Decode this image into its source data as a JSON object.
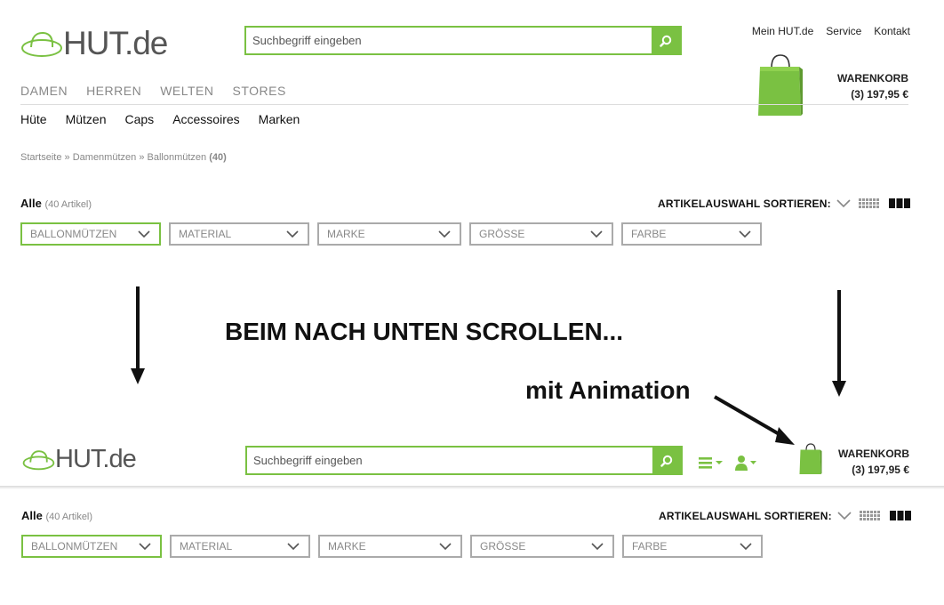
{
  "header": {
    "logo_text": "HUT.de",
    "search_placeholder": "Suchbegriff eingeben",
    "top_links": [
      "Mein HUT.de",
      "Service",
      "Kontakt"
    ],
    "cart_title": "WARENKORB",
    "cart_summary": "(3) 197,95 €"
  },
  "main_nav": [
    "DAMEN",
    "HERREN",
    "WELTEN",
    "STORES"
  ],
  "sub_nav": [
    "Hüte",
    "Mützen",
    "Caps",
    "Accessoires",
    "Marken"
  ],
  "breadcrumb": {
    "item1": "Startseite",
    "sep": "»",
    "item2": "Damenmützen",
    "item3": "Ballonmützen",
    "count": "(40)"
  },
  "filter": {
    "title": "Alle",
    "count": "(40 Artikel)",
    "sort_label": "ARTIKELAUSWAHL SORTIEREN:",
    "dropdowns": [
      "BALLONMÜTZEN",
      "MATERIAL",
      "MARKE",
      "GRÖSSE",
      "FARBE"
    ]
  },
  "annotations": {
    "scroll_text": "BEIM NACH UNTEN SCROLLEN...",
    "animation_text": "mit Animation"
  },
  "sticky": {
    "logo_text": "HUT.de",
    "search_placeholder": "Suchbegriff eingeben",
    "cart_title": "WARENKORB",
    "cart_summary": "(3) 197,95 €"
  },
  "colors": {
    "accent": "#7ac142",
    "border_gray": "#aaaaaa",
    "text_gray": "#888888"
  }
}
